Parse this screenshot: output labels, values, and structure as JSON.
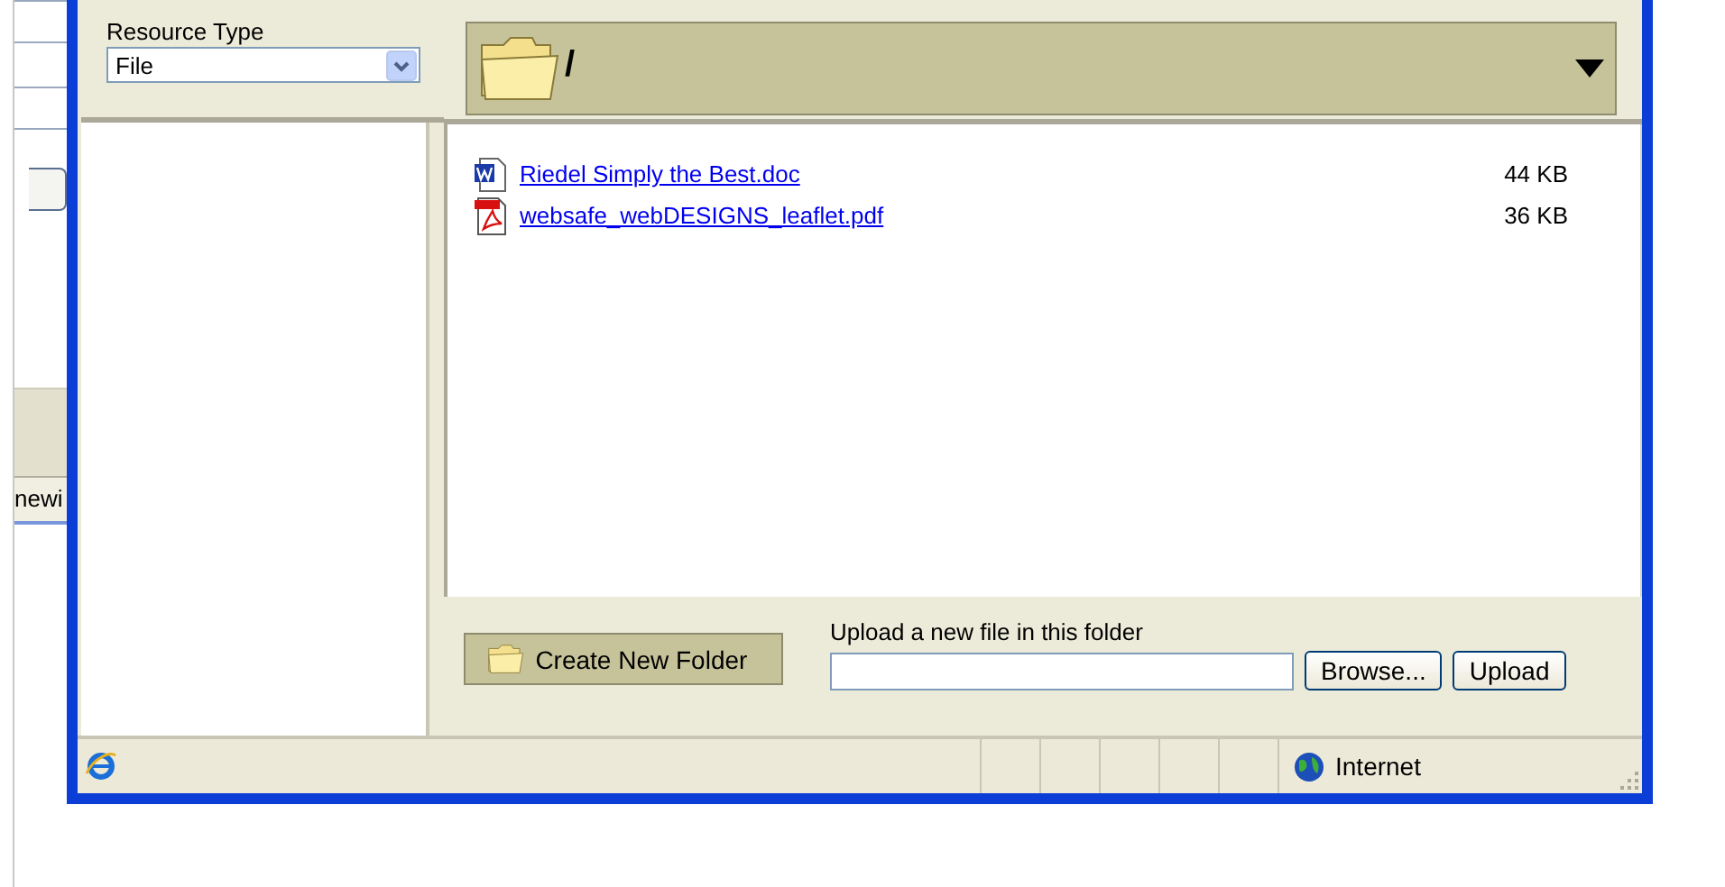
{
  "background_page": {
    "tab_fragment": "newi"
  },
  "resource_type": {
    "label": "Resource Type",
    "value": "File"
  },
  "folder_bar": {
    "path": "/"
  },
  "files": [
    {
      "name": "Riedel Simply the Best.doc",
      "size": "44 KB",
      "kind": "word"
    },
    {
      "name": "websafe_webDESIGNS_leaflet.pdf",
      "size": "36 KB",
      "kind": "pdf"
    }
  ],
  "create_folder_button": "Create New Folder",
  "upload": {
    "label": "Upload a new file in this folder",
    "browse_button": "Browse...",
    "upload_button": "Upload"
  },
  "status_bar": {
    "zone": "Internet"
  }
}
